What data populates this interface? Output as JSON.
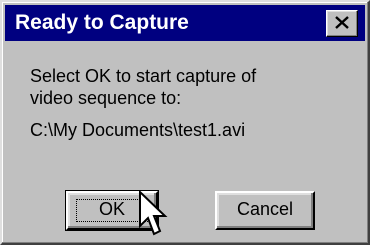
{
  "dialog": {
    "title": "Ready to Capture",
    "message_line1": "Select OK to start capture of",
    "message_line2": "video sequence to:",
    "file_path": "C:\\My Documents\\test1.avi",
    "ok_label": "OK",
    "cancel_label": "Cancel"
  },
  "icons": {
    "close": "close-icon",
    "cursor": "mouse-pointer-icon"
  },
  "colors": {
    "titlebar": "#000080",
    "face": "#c0c0c0",
    "title_text": "#ffffff"
  }
}
